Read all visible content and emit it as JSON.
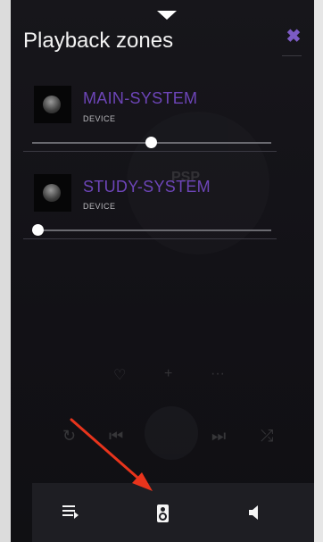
{
  "panel": {
    "title": "Playback zones",
    "close_icon": "close-icon"
  },
  "zones": [
    {
      "name": "MAIN-SYSTEM",
      "type": "DEVICE",
      "volume": 0.5
    },
    {
      "name": "STUDY-SYSTEM",
      "type": "DEVICE",
      "volume": 0.0
    }
  ],
  "background_player": {
    "brand": "PSP"
  },
  "bottom_bar": {
    "icons": [
      "queue-icon",
      "speaker-icon",
      "volume-icon"
    ]
  },
  "colors": {
    "accent": "#6d45b8",
    "close": "#7c5bc4",
    "annotation_arrow": "#e8341c"
  }
}
